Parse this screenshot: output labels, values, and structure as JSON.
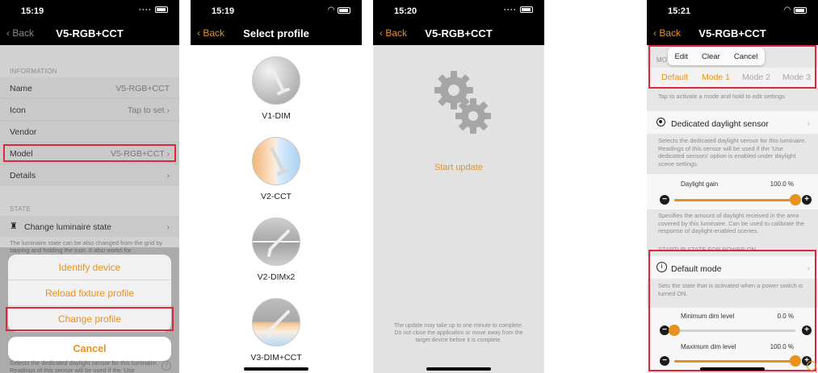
{
  "colors": {
    "accent": "#e8921d",
    "highlight": "#d9293b",
    "navbar": "#000000"
  },
  "screen1": {
    "time": "15:19",
    "back": "Back",
    "title": "V5-RGB+CCT",
    "info_header": "INFORMATION",
    "rows": [
      {
        "label": "Name",
        "value": "V5-RGB+CCT"
      },
      {
        "label": "Icon",
        "value": "Tap to set"
      },
      {
        "label": "Vendor",
        "value": ""
      },
      {
        "label": "Model",
        "value": "V5-RGB+CCT"
      },
      {
        "label": "Details",
        "value": ""
      }
    ],
    "state_header": "STATE",
    "change_state": "Change luminaire state",
    "state_note": "The luminaire state can be also changed from the grid by tapping and holding the icon. It also works for",
    "sheet": {
      "identify": "Identify device",
      "reload": "Reload fixture profile",
      "change": "Change profile",
      "cancel": "Cancel"
    },
    "bottom_note": "Selects the dedicated daylight sensor for this luminaire. Readings of this sensor will be used if the 'Use"
  },
  "screen2": {
    "time": "15:19",
    "back": "Back",
    "title": "Select profile",
    "profiles": [
      "V1-DIM",
      "V2-CCT",
      "V2-DIMx2",
      "V3-DIM+CCT"
    ]
  },
  "screen3": {
    "time": "15:20",
    "back": "Back",
    "title": "V5-RGB+CCT",
    "start_update": "Start update",
    "note": "The update may take up to one minute to complete. Do not close the application or move away from the target device before it is complete."
  },
  "screen4": {
    "time": "15:21",
    "back": "Back",
    "title": "V5-RGB+CCT",
    "mode_header_fragment": "MO",
    "popover": [
      "Edit",
      "Clear",
      "Cancel"
    ],
    "modes": [
      "Default",
      "Mode 1",
      "Mode 2",
      "Mode 3"
    ],
    "active_mode": "Mode 1",
    "modes_hint": "Tap to activate a mode and hold to edit settings",
    "daylight_sensor": "Dedicated daylight sensor",
    "daylight_note": "Selects the dedicated daylight sensor for this luminaire. Readings of this sensor will be used if the 'Use dedicated sensors' option is enabled under daylight scene settings.",
    "daylight_gain": {
      "label": "Daylight gain",
      "value_text": "100.0 %",
      "fraction": 1.0
    },
    "gain_note": "Specifies the amount of daylight received in the area covered by this luminaire. Can be used to calibrate the response of daylight-enabled scenes.",
    "startup_header": "STARTUP STATE FOR POWER ON",
    "default_mode": "Default mode",
    "default_note": "Sets the state that is activated when a power switch is turned ON.",
    "min_dim": {
      "label": "Minimum dim level",
      "value_text": "0.0 %",
      "fraction": 0.0
    },
    "max_dim": {
      "label": "Maximum dim level",
      "value_text": "100.0 %",
      "fraction": 1.0
    }
  }
}
